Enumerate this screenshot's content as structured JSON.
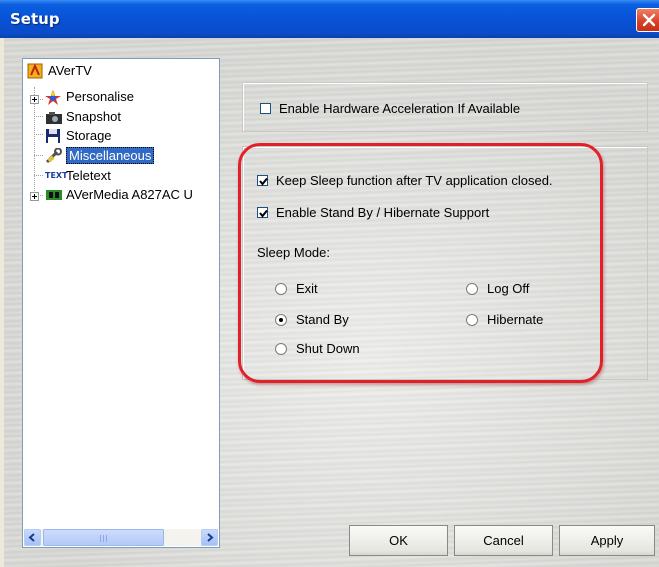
{
  "window": {
    "title": "Setup"
  },
  "tree": {
    "items": [
      {
        "label": "AVerTV",
        "icon": "avertv-icon"
      },
      {
        "label": "Personalise",
        "icon": "personalise-icon"
      },
      {
        "label": "Snapshot",
        "icon": "camera-icon"
      },
      {
        "label": "Storage",
        "icon": "floppy-disk-icon"
      },
      {
        "label": "Miscellaneous",
        "icon": "wrench-icon",
        "selected": true
      },
      {
        "label": "Teletext",
        "icon": "teletext-icon",
        "icon_text": "TEXT"
      },
      {
        "label": "AVerMedia A827AC U",
        "icon": "device-icon"
      }
    ]
  },
  "options": {
    "hw_accel": {
      "label": "Enable Hardware Acceleration If Available",
      "checked": false
    },
    "keep_sleep": {
      "label": "Keep Sleep function after TV application closed.",
      "checked": true
    },
    "standby_support": {
      "label": "Enable Stand By / Hibernate Support",
      "checked": true
    },
    "sleep_mode": {
      "label": "Sleep Mode:",
      "choices": [
        {
          "label": "Exit",
          "selected": false
        },
        {
          "label": "Log Off",
          "selected": false
        },
        {
          "label": "Stand By",
          "selected": true
        },
        {
          "label": "Hibernate",
          "selected": false
        },
        {
          "label": "Shut Down",
          "selected": false
        }
      ]
    }
  },
  "buttons": {
    "ok": "OK",
    "cancel": "Cancel",
    "apply": "Apply"
  },
  "colors": {
    "titlebar": "#0852d6",
    "selection": "#316ac5",
    "highlight": "#e2202a"
  }
}
